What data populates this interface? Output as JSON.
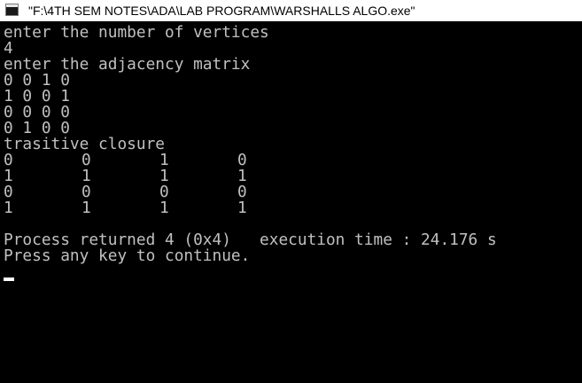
{
  "window": {
    "title": "\"F:\\4TH SEM NOTES\\ADA\\LAB PROGRAM\\WARSHALLS ALGO.exe\""
  },
  "console": {
    "prompt_vertices": "enter the number of vertices",
    "input_vertices": "4",
    "prompt_matrix": "enter the adjacency matrix",
    "matrix_rows": [
      "0 0 1 0",
      "1 0 0 1",
      "0 0 0 0",
      "0 1 0 0"
    ],
    "closure_heading": "trasitive closure",
    "closure_rows": [
      [
        "0",
        "0",
        "1",
        "0"
      ],
      [
        "1",
        "1",
        "1",
        "1"
      ],
      [
        "0",
        "0",
        "0",
        "0"
      ],
      [
        "1",
        "1",
        "1",
        "1"
      ]
    ],
    "process_line": "Process returned 4 (0x4)   execution time : 24.176 s",
    "continue_line": "Press any key to continue."
  },
  "colors": {
    "background": "#000000",
    "text": "#c0c0c0",
    "titlebar": "#ffffff"
  },
  "icons": [
    "console-app-icon"
  ]
}
